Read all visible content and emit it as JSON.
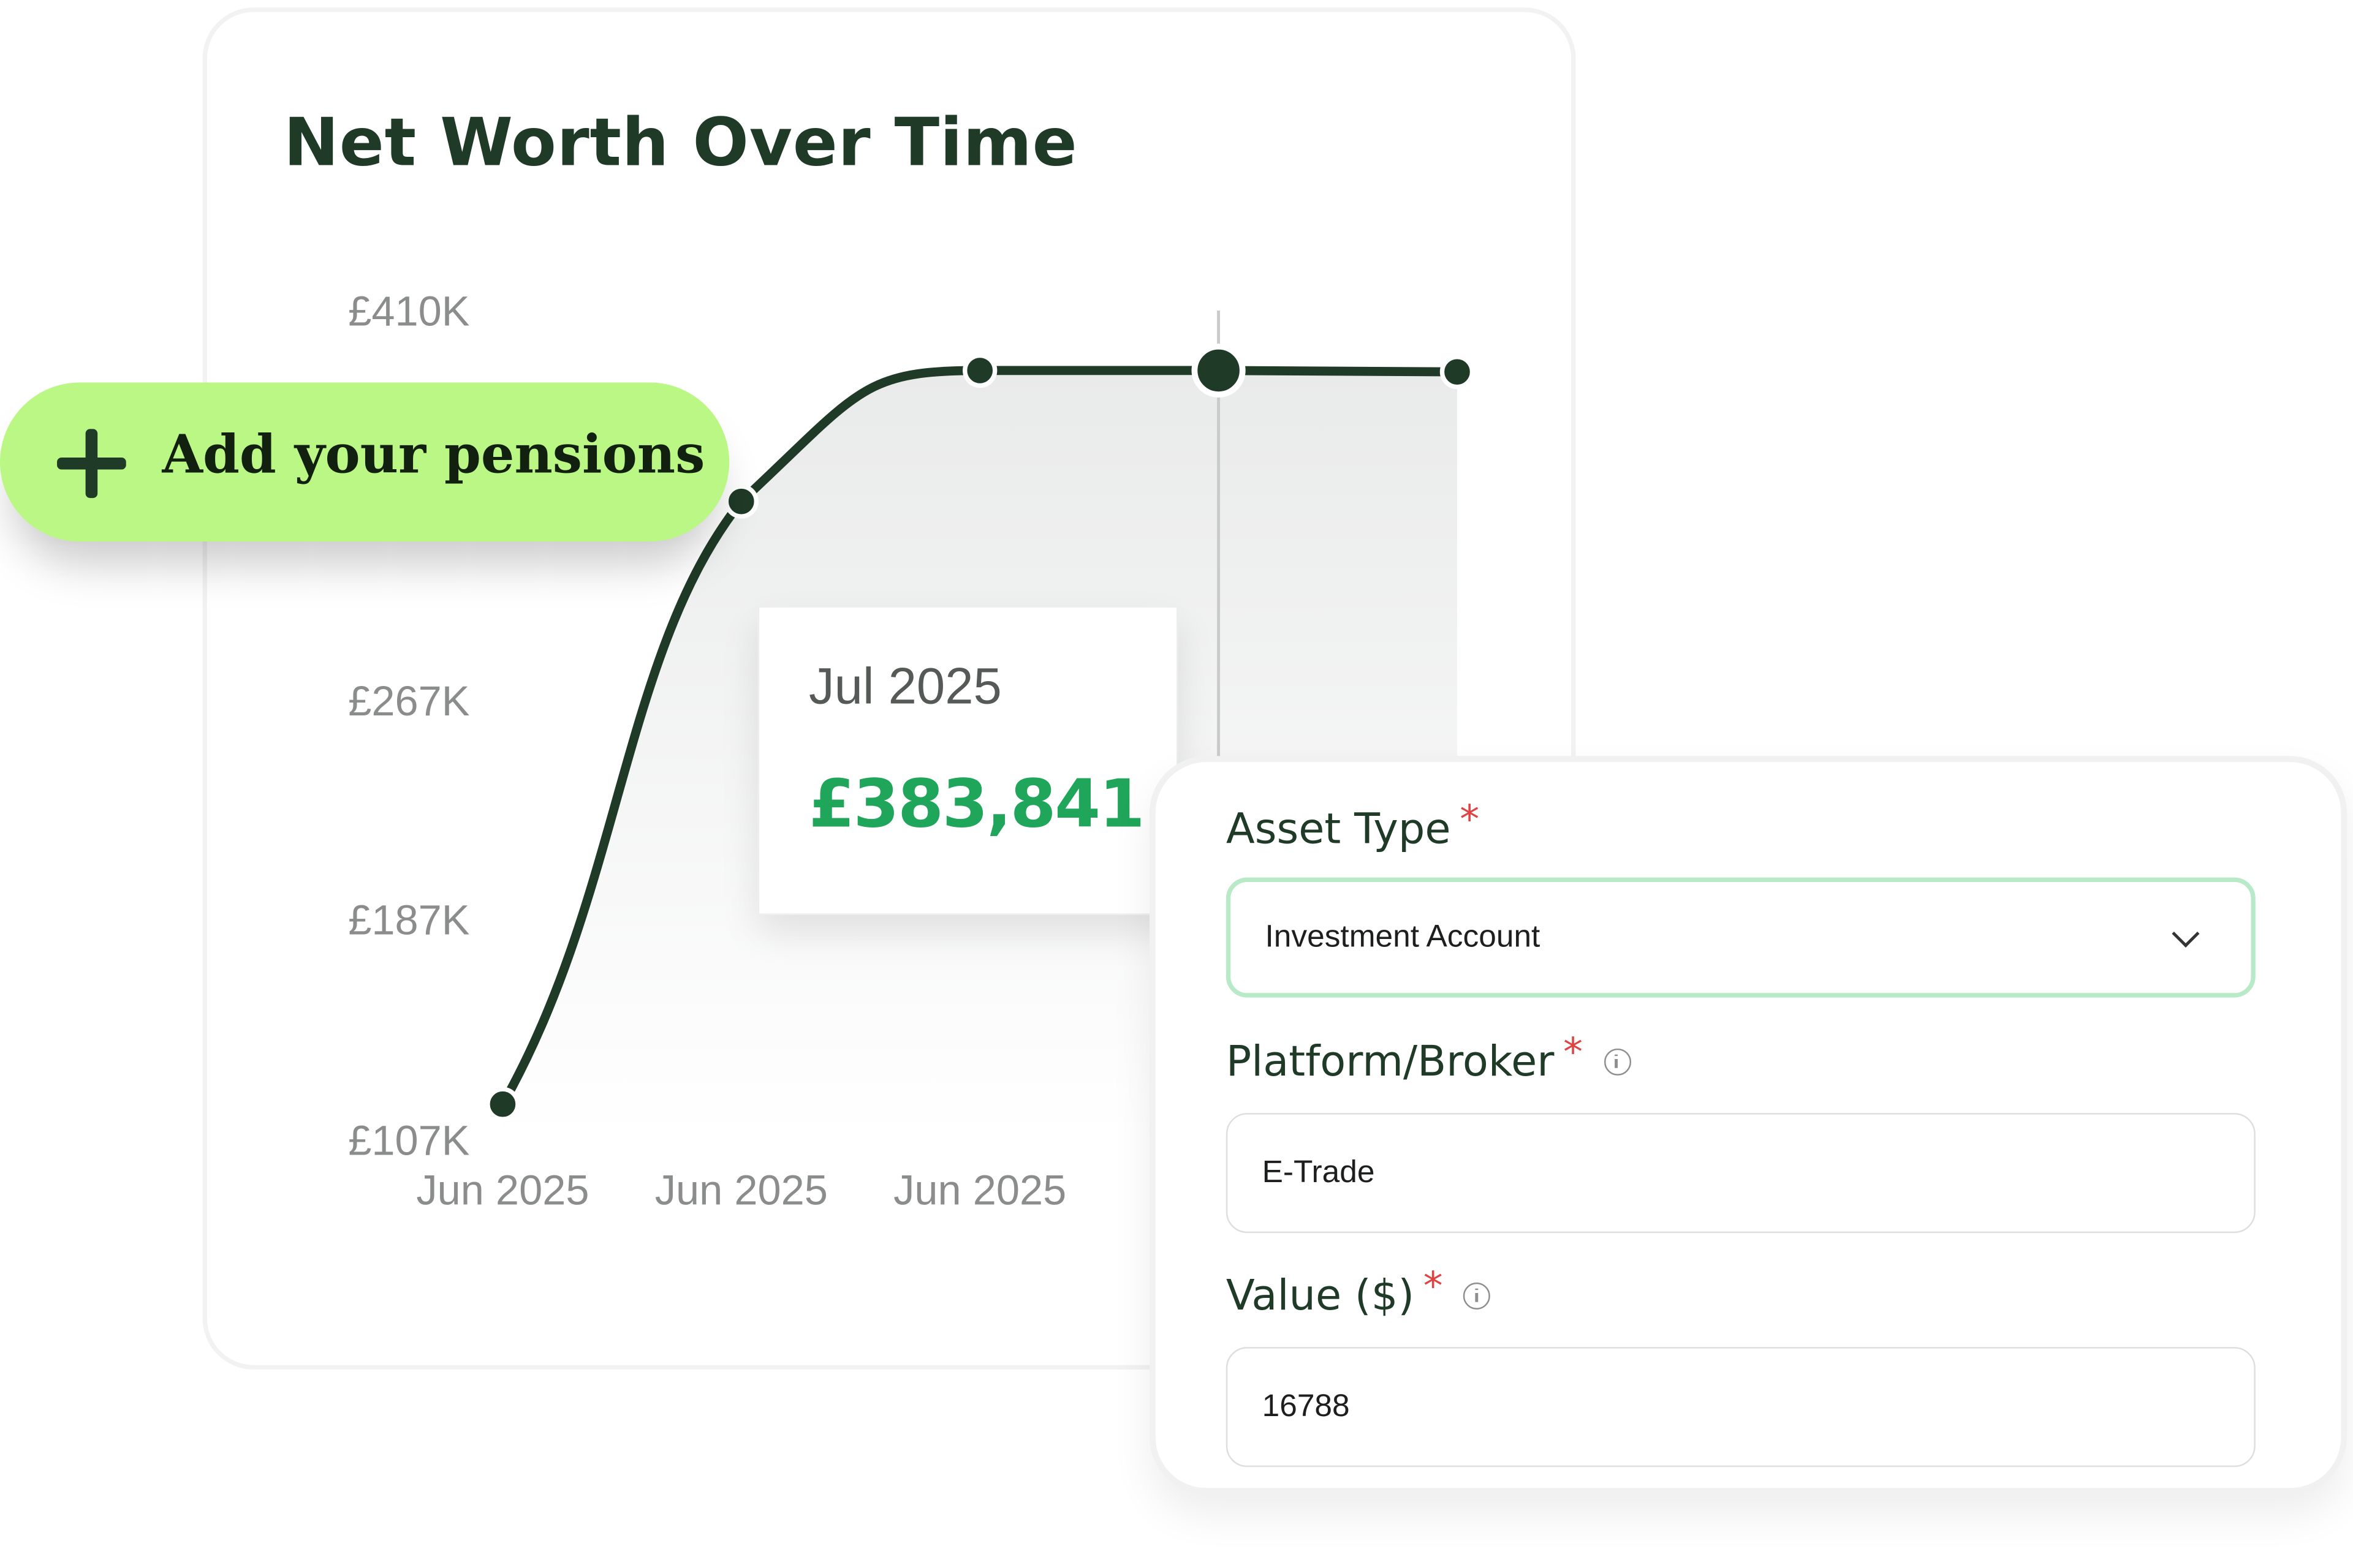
{
  "chart_card": {
    "title": "Net Worth Over Time"
  },
  "chart_data": {
    "type": "line",
    "title": "Net Worth Over Time",
    "x": [
      "Jun 2025",
      "Jun 2025",
      "Jun 2025",
      "Jul 2025",
      "Jul 2025"
    ],
    "x_tick_labels": [
      "Jun 2025",
      "Jun 2025",
      "Jun 2025"
    ],
    "values": [
      120000,
      340000,
      388000,
      388000,
      387500
    ],
    "y_tick_labels": [
      "£410K",
      "£267K",
      "£187K",
      "£107K"
    ],
    "y_ticks": [
      410000,
      267000,
      187000,
      107000
    ],
    "highlighted_index": 3,
    "grid": false,
    "fill": "area",
    "line_color": "#1f3a27"
  },
  "tooltip": {
    "date": "Jul 2025",
    "value": "£383,841"
  },
  "promo": {
    "label": "Add your pensions",
    "icon": "plus-icon"
  },
  "form": {
    "asset_type": {
      "label": "Asset Type",
      "required_mark": "*",
      "value": "Investment Account"
    },
    "platform": {
      "label": "Platform/Broker",
      "required_mark": "*",
      "value": "E-Trade"
    },
    "value_field": {
      "label": "Value ($)",
      "required_mark": "*",
      "value": "16788"
    }
  },
  "colors": {
    "brand_dark": "#1f3a27",
    "accent_green": "#bbf784",
    "value_green": "#1fa65a",
    "required_red": "#e04343"
  }
}
